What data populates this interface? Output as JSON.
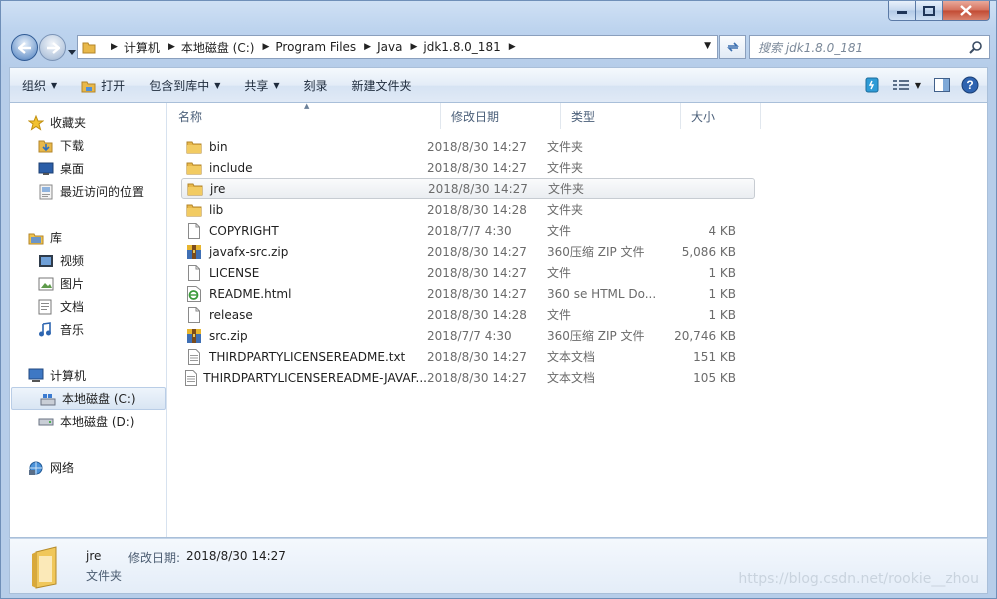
{
  "window": {
    "accent": "#3e6aa6"
  },
  "navigation": {
    "back_icon": "back-arrow-icon",
    "forward_icon": "forward-arrow-icon",
    "breadcrumbs": [
      "计算机",
      "本地磁盘 (C:)",
      "Program Files",
      "Java",
      "jdk1.8.0_181"
    ],
    "search_placeholder": "搜索 jdk1.8.0_181"
  },
  "toolbar": {
    "organize": "组织",
    "open": "打开",
    "include_in_library": "包含到库中",
    "share": "共享",
    "burn": "刻录",
    "new_folder": "新建文件夹"
  },
  "sidebar": {
    "favorites": {
      "label": "收藏夹",
      "items": [
        "下载",
        "桌面",
        "最近访问的位置"
      ]
    },
    "libraries": {
      "label": "库",
      "items": [
        "视频",
        "图片",
        "文档",
        "音乐"
      ]
    },
    "computer": {
      "label": "计算机",
      "items": [
        "本地磁盘 (C:)",
        "本地磁盘 (D:)"
      ]
    },
    "network": {
      "label": "网络"
    }
  },
  "columns": {
    "name": "名称",
    "date": "修改日期",
    "type": "类型",
    "size": "大小"
  },
  "files": [
    {
      "name": "bin",
      "date": "2018/8/30 14:27",
      "type": "文件夹",
      "size": "",
      "icon": "folder"
    },
    {
      "name": "include",
      "date": "2018/8/30 14:27",
      "type": "文件夹",
      "size": "",
      "icon": "folder"
    },
    {
      "name": "jre",
      "date": "2018/8/30 14:27",
      "type": "文件夹",
      "size": "",
      "icon": "folder"
    },
    {
      "name": "lib",
      "date": "2018/8/30 14:28",
      "type": "文件夹",
      "size": "",
      "icon": "folder"
    },
    {
      "name": "COPYRIGHT",
      "date": "2018/7/7 4:30",
      "type": "文件",
      "size": "4 KB",
      "icon": "file"
    },
    {
      "name": "javafx-src.zip",
      "date": "2018/8/30 14:27",
      "type": "360压缩 ZIP 文件",
      "size": "5,086 KB",
      "icon": "zip"
    },
    {
      "name": "LICENSE",
      "date": "2018/8/30 14:27",
      "type": "文件",
      "size": "1 KB",
      "icon": "file"
    },
    {
      "name": "README.html",
      "date": "2018/8/30 14:27",
      "type": "360 se HTML Do...",
      "size": "1 KB",
      "icon": "html"
    },
    {
      "name": "release",
      "date": "2018/8/30 14:28",
      "type": "文件",
      "size": "1 KB",
      "icon": "file"
    },
    {
      "name": "src.zip",
      "date": "2018/7/7 4:30",
      "type": "360压缩 ZIP 文件",
      "size": "20,746 KB",
      "icon": "zip"
    },
    {
      "name": "THIRDPARTYLICENSEREADME.txt",
      "date": "2018/8/30 14:27",
      "type": "文本文档",
      "size": "151 KB",
      "icon": "txt"
    },
    {
      "name": "THIRDPARTYLICENSEREADME-JAVAF...",
      "date": "2018/8/30 14:27",
      "type": "文本文档",
      "size": "105 KB",
      "icon": "txt"
    }
  ],
  "details": {
    "name": "jre",
    "type": "文件夹",
    "modified_label": "修改日期:",
    "modified_value": "2018/8/30 14:27"
  },
  "watermark": "https://blog.csdn.net/rookie__zhou"
}
